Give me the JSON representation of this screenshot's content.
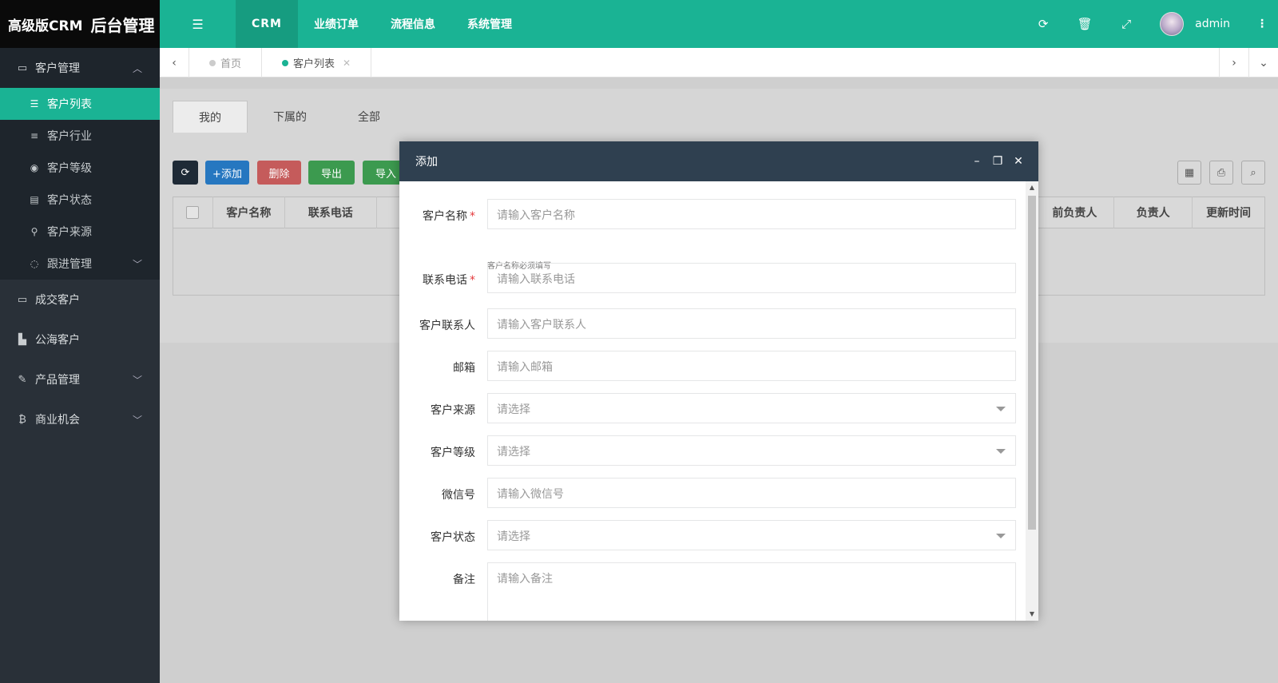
{
  "brand": {
    "name": "高级版CRM",
    "subtitle": "后台管理"
  },
  "sidebar": {
    "groups": [
      {
        "label": "客户管理",
        "icon": "id-card-icon",
        "expanded": true,
        "items": [
          {
            "label": "客户列表",
            "icon": "list-icon",
            "active": true
          },
          {
            "label": "客户行业",
            "icon": "align-center-icon"
          },
          {
            "label": "客户等级",
            "icon": "compass-icon"
          },
          {
            "label": "客户状态",
            "icon": "newspaper-icon"
          },
          {
            "label": "客户来源",
            "icon": "walking-icon"
          },
          {
            "label": "跟进管理",
            "icon": "comments-icon"
          }
        ]
      }
    ],
    "plain": [
      {
        "label": "成交客户",
        "icon": "id-card-icon"
      },
      {
        "label": "公海客户",
        "icon": "bar-chart-icon"
      },
      {
        "label": "产品管理",
        "icon": "brush-icon"
      },
      {
        "label": "商业机会",
        "icon": "bitcoin-icon"
      }
    ]
  },
  "topbar": {
    "tabs": [
      "CRM",
      "业绩订单",
      "流程信息",
      "系统管理"
    ],
    "active_tab": "CRM",
    "user": "admin",
    "accent": "#1ab394"
  },
  "page_tabs": [
    {
      "label": "首页",
      "active": false
    },
    {
      "label": "客户列表",
      "active": true
    }
  ],
  "list": {
    "sub_tabs": [
      "我的",
      "下属的",
      "全部"
    ],
    "toolbar": {
      "add": "+添加",
      "delete": "删除",
      "export": "导出",
      "import": "导入"
    },
    "columns": [
      "客户名称",
      "联系电话",
      "前负责人",
      "负责人",
      "更新时间"
    ]
  },
  "modal": {
    "title": "添加",
    "fields": [
      {
        "label": "客户名称",
        "required": true,
        "placeholder": "请输入客户名称",
        "help": "客户名称必须填写"
      },
      {
        "label": "联系电话",
        "required": true,
        "placeholder": "请输入联系电话"
      },
      {
        "label": "客户联系人",
        "placeholder": "请输入客户联系人"
      },
      {
        "label": "邮箱",
        "placeholder": "请输入邮箱"
      },
      {
        "label": "客户来源",
        "placeholder": "请选择",
        "type": "select"
      },
      {
        "label": "客户等级",
        "placeholder": "请选择",
        "type": "select"
      },
      {
        "label": "微信号",
        "placeholder": "请输入微信号"
      },
      {
        "label": "客户状态",
        "placeholder": "请选择",
        "type": "select"
      },
      {
        "label": "备注",
        "placeholder": "请输入备注",
        "type": "textarea"
      }
    ]
  }
}
